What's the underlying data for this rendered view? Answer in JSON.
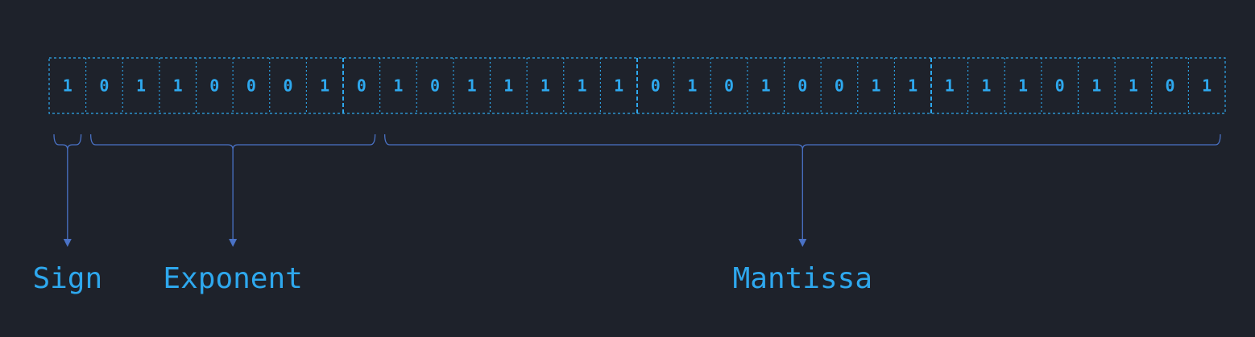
{
  "bits": [
    "1",
    "0",
    "1",
    "1",
    "0",
    "0",
    "0",
    "1",
    "0",
    "1",
    "0",
    "1",
    "1",
    "1",
    "1",
    "1",
    "0",
    "1",
    "0",
    "1",
    "0",
    "0",
    "1",
    "1",
    "1",
    "1",
    "1",
    "0",
    "1",
    "1",
    "0",
    "1"
  ],
  "fields": [
    {
      "label": "Sign",
      "start": 0,
      "end": 0
    },
    {
      "label": "Exponent",
      "start": 1,
      "end": 8
    },
    {
      "label": "Mantissa",
      "start": 9,
      "end": 31
    }
  ],
  "colors": {
    "background": "#1e222b",
    "accent": "#2ea8ee",
    "bracket": "#4a72c6"
  }
}
